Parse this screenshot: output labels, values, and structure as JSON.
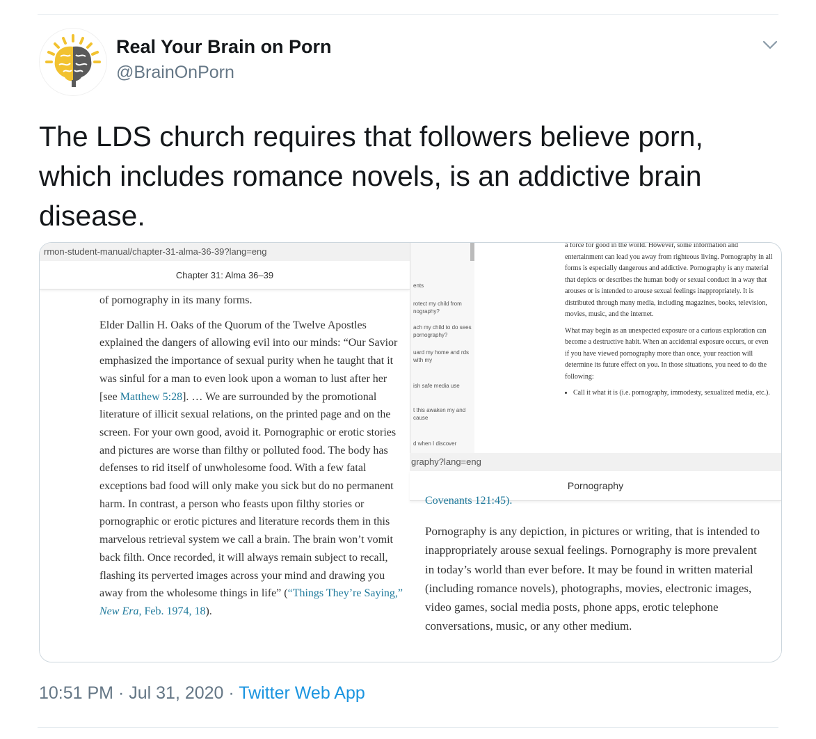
{
  "author": {
    "name": "Real Your Brain on Porn",
    "handle": "@BrainOnPorn"
  },
  "tweet": {
    "text": "The LDS church requires that followers believe porn, which includes romance novels, is an addictive brain disease."
  },
  "screenshot": {
    "left_panel": {
      "url": "rmon-student-manual/chapter-31-alma-36-39?lang=eng",
      "page_title": "Chapter 31: Alma 36–39",
      "para1": "of pornography in its many forms.",
      "para2_a": "Elder Dallin H. Oaks of the Quorum of the Twelve Apostles explained the dangers of allowing evil into our minds: “Our Savior emphasized the importance of sexual purity when he taught that it was sinful for a man to even look upon a woman to lust after her [see ",
      "para2_link": "Matthew 5:28",
      "para2_b": "]. … We are surrounded by the promotional literature of illicit sexual relations, on the printed page and on the screen. For your own good, avoid it. Pornographic or erotic stories and pictures are worse than filthy or polluted food. The body has defenses to rid itself of unwholesome food. With a few fatal exceptions bad food will only make you sick but do no permanent harm. In contrast, a person who feasts upon filthy stories or pornographic or erotic pictures and literature records them in this marvelous retrieval system we call a brain. The brain won’t vomit back filth. Once recorded, it will always remain subject to recall, flashing its perverted images across your mind and drawing you away from the wholesome things in life” (",
      "citation_a": "“Things They’re Saying,” ",
      "citation_italic": "New Era",
      "citation_b": ", Feb. 1974, 18",
      "para2_end": ")."
    },
    "sidebar": {
      "items": [
        "ents",
        "rotect my child from nography?",
        "ach my child to do sees pornography?",
        "uard my home and rds with my",
        "ish safe media use",
        "t this awaken my and cause",
        "d when I discover"
      ]
    },
    "back_chevron": "‹",
    "right_panel": {
      "line1": "a force for good in the world. However, some information and entertainment can lead you away from righteous living. Pornography in all forms is especially dangerous and addictive. Pornography is any material that depicts or describes the human body or sexual conduct in a way that arouses or is intended to arouse sexual feelings inappropriately. It is distributed through many media, including magazines, books, television, movies, music, and the internet.",
      "line2": "What may begin as an unexpected exposure or a curious exploration can become a destructive habit. When an accidental exposure occurs, or even if you have viewed pornography more than once, your reaction will determine its future effect on you. In those situations, you need to do the following:",
      "bullet": "Call it what it is (i.e. pornography, immodesty, sexualized media, etc.)."
    },
    "bottom_panel": {
      "url": "graphy?lang=eng",
      "page_title": "Pornography",
      "cut_text": "Covenants 121:45).",
      "body": "Pornography is any depiction, in pictures or writing, that is intended to inappropriately arouse sexual feelings. Pornography is more prevalent in today’s world than ever before. It may be found in written material (including romance novels), photographs, movies, electronic images, video games, social media posts, phone apps, erotic telephone conversations, music, or any other medium."
    }
  },
  "meta": {
    "time": "10:51 PM",
    "sep1": " · ",
    "date": "Jul 31, 2020",
    "sep2": " · ",
    "source": "Twitter Web App"
  },
  "colors": {
    "brand_blue": "#1b95e0",
    "muted": "#657786",
    "link_teal": "#1f7a9c"
  },
  "icons": {
    "menu": "chevron-down-icon",
    "avatar": "brain-logo"
  }
}
